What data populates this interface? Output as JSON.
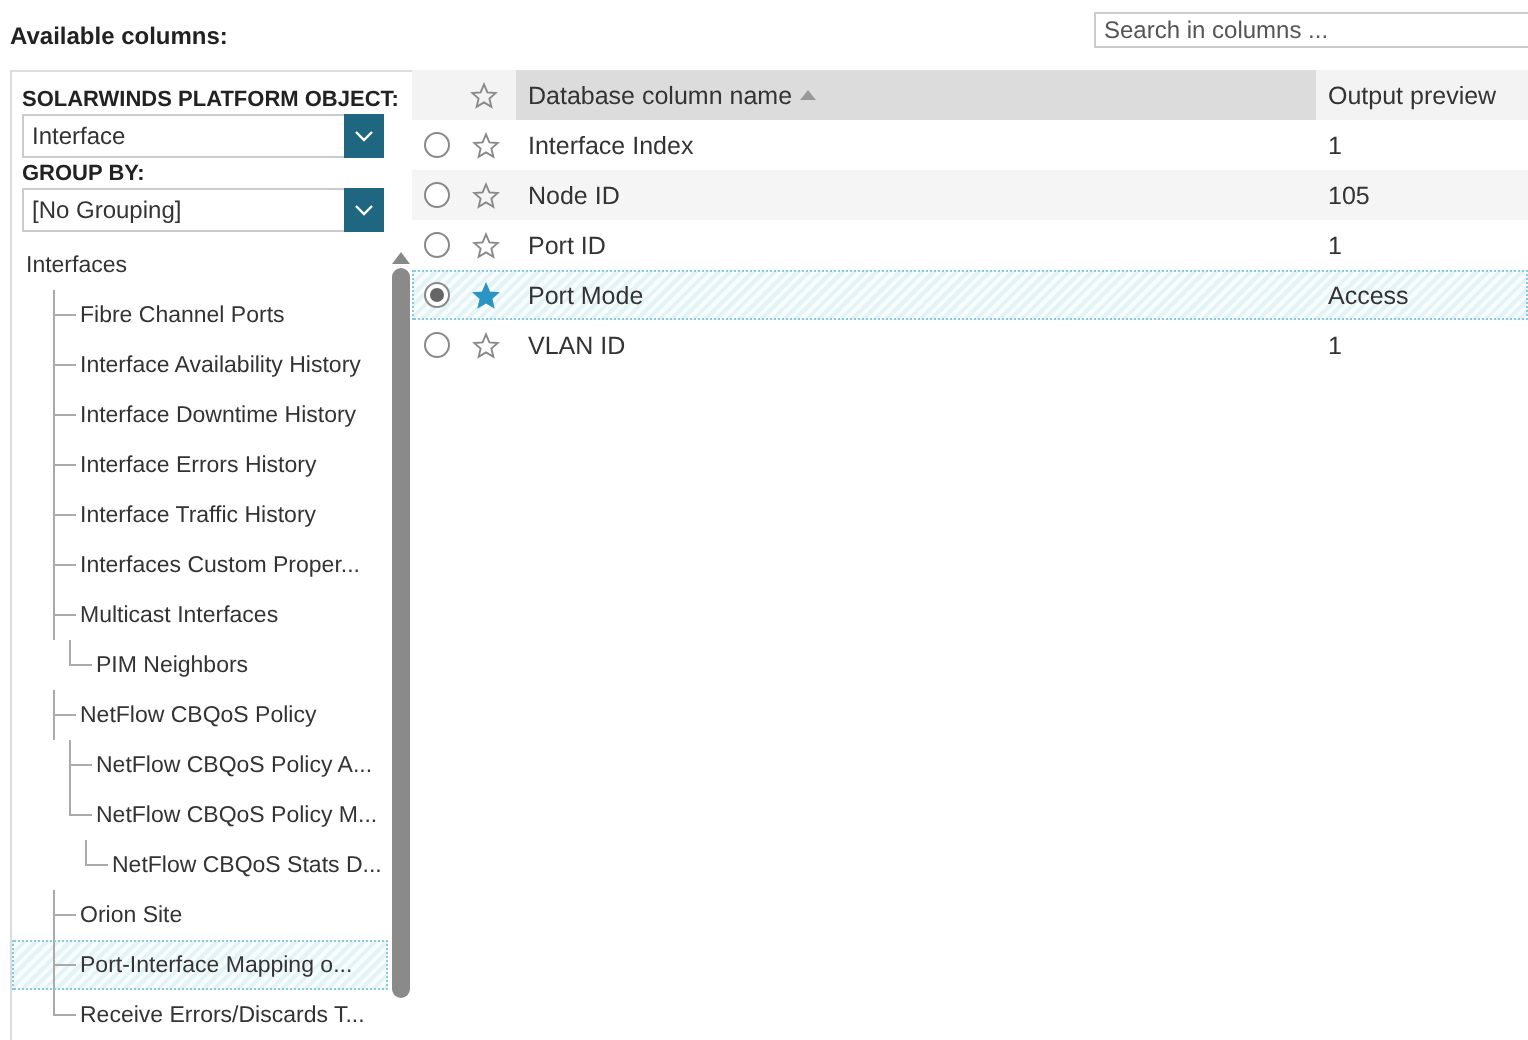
{
  "title": "Available columns:",
  "search": {
    "placeholder": "Search in columns ..."
  },
  "object_select": {
    "label": "SOLARWINDS PLATFORM OBJECT:",
    "value": "Interface"
  },
  "group_select": {
    "label": "GROUP BY:",
    "value": "[No Grouping]"
  },
  "tree": [
    {
      "label": "Interfaces",
      "selected": false,
      "children": [
        {
          "label": "Fibre Channel Ports",
          "selected": false
        },
        {
          "label": "Interface Availability History",
          "selected": false
        },
        {
          "label": "Interface Downtime History",
          "selected": false
        },
        {
          "label": "Interface Errors History",
          "selected": false
        },
        {
          "label": "Interface Traffic History",
          "selected": false
        },
        {
          "label": "Interfaces Custom Proper...",
          "selected": false
        },
        {
          "label": "Multicast Interfaces",
          "selected": false,
          "children": [
            {
              "label": "PIM Neighbors",
              "selected": false
            }
          ]
        },
        {
          "label": "NetFlow CBQoS Policy",
          "selected": false,
          "children": [
            {
              "label": "NetFlow CBQoS Policy A...",
              "selected": false
            },
            {
              "label": "NetFlow CBQoS Policy M...",
              "selected": false,
              "children": [
                {
                  "label": "NetFlow CBQoS Stats D...",
                  "selected": false
                }
              ]
            }
          ]
        },
        {
          "label": "Orion Site",
          "selected": false
        },
        {
          "label": "Port-Interface Mapping o...",
          "selected": true
        },
        {
          "label": "Receive Errors/Discards T...",
          "selected": false
        }
      ]
    }
  ],
  "table": {
    "columns": [
      {
        "label": "Database column name",
        "sorted": true
      },
      {
        "label": "Output preview",
        "sorted": false
      }
    ],
    "rows": [
      {
        "name": "Interface Index",
        "preview": "1",
        "selected": false,
        "starred": false
      },
      {
        "name": "Node ID",
        "preview": "105",
        "selected": false,
        "starred": false
      },
      {
        "name": "Port ID",
        "preview": "1",
        "selected": false,
        "starred": false
      },
      {
        "name": "Port Mode",
        "preview": "Access",
        "selected": true,
        "starred": true
      },
      {
        "name": "VLAN ID",
        "preview": "1",
        "selected": false,
        "starred": false
      }
    ]
  }
}
